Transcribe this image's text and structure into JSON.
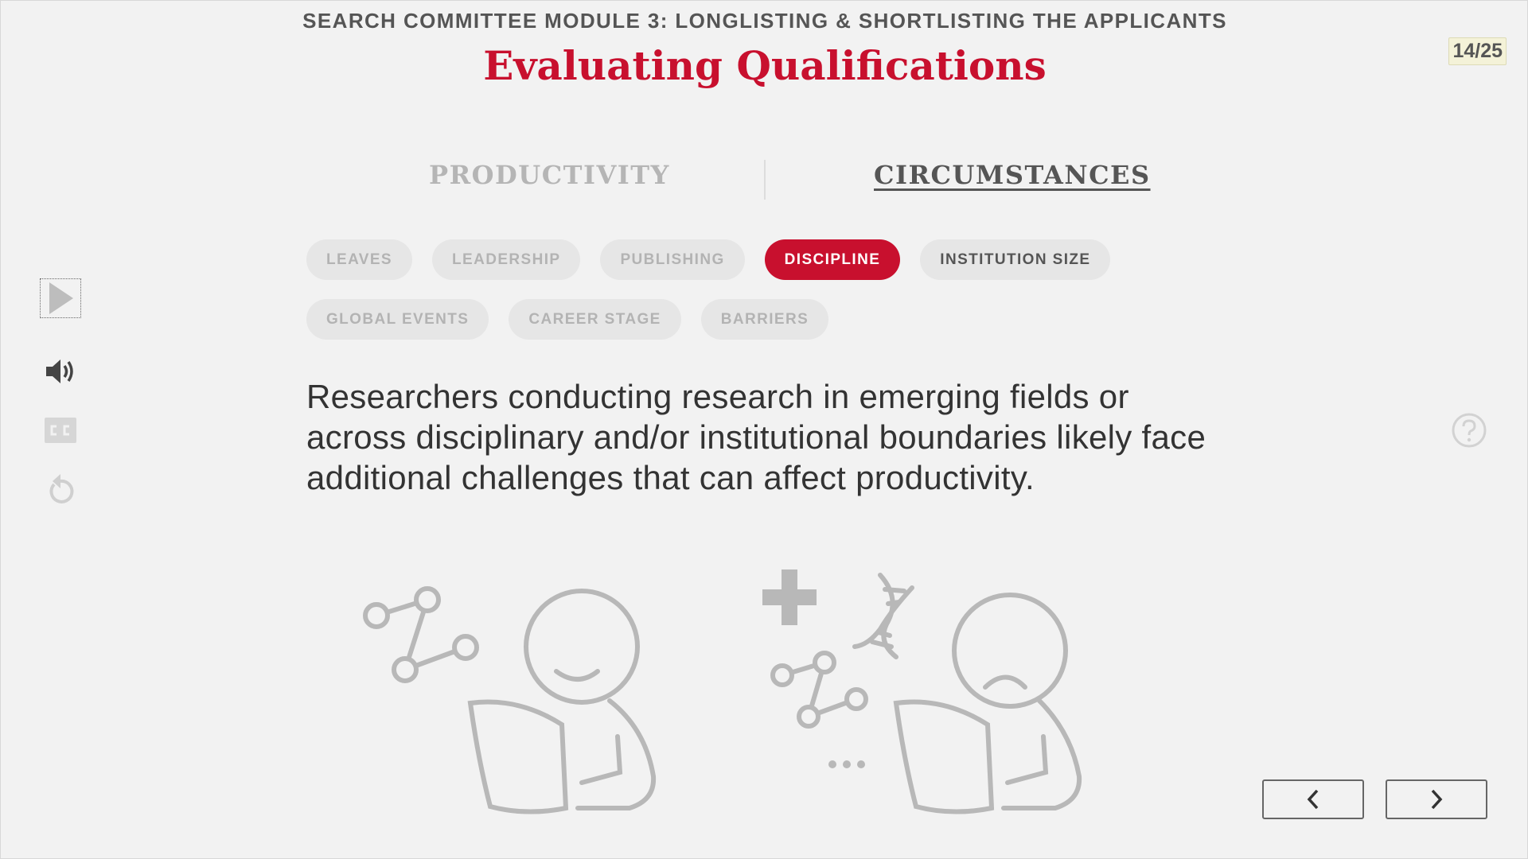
{
  "header": {
    "module_title": "SEARCH COMMITTEE MODULE 3: LONGLISTING & SHORTLISTING THE APPLICANTS",
    "slide_title": "Evaluating Qualifications",
    "page_counter": "14/25"
  },
  "main_tabs": [
    {
      "label": "PRODUCTIVITY",
      "active": false
    },
    {
      "label": "CIRCUMSTANCES",
      "active": true
    }
  ],
  "chips": {
    "row1": [
      {
        "label": "LEAVES",
        "state": "inactive"
      },
      {
        "label": "LEADERSHIP",
        "state": "inactive"
      },
      {
        "label": "PUBLISHING",
        "state": "inactive"
      },
      {
        "label": "DISCIPLINE",
        "state": "selected"
      },
      {
        "label": "INSTITUTION SIZE",
        "state": "hover"
      }
    ],
    "row2": [
      {
        "label": "GLOBAL EVENTS",
        "state": "inactive"
      },
      {
        "label": "CAREER STAGE",
        "state": "inactive"
      },
      {
        "label": "BARRIERS",
        "state": "inactive"
      }
    ]
  },
  "content": {
    "body": "Researchers conducting research in emerging fields or across disciplinary and/or institutional boundaries likely face additional challenges that can affect productivity."
  },
  "controls": {
    "icons": [
      "play-icon",
      "volume-icon",
      "closed-captions-icon",
      "replay-icon",
      "help-icon",
      "chevron-left-icon",
      "chevron-right-icon"
    ],
    "cc_label": "CC"
  },
  "colors": {
    "accent": "#c8102e",
    "text": "#333333",
    "muted": "#b5b5b5",
    "background": "#f2f2f2"
  }
}
